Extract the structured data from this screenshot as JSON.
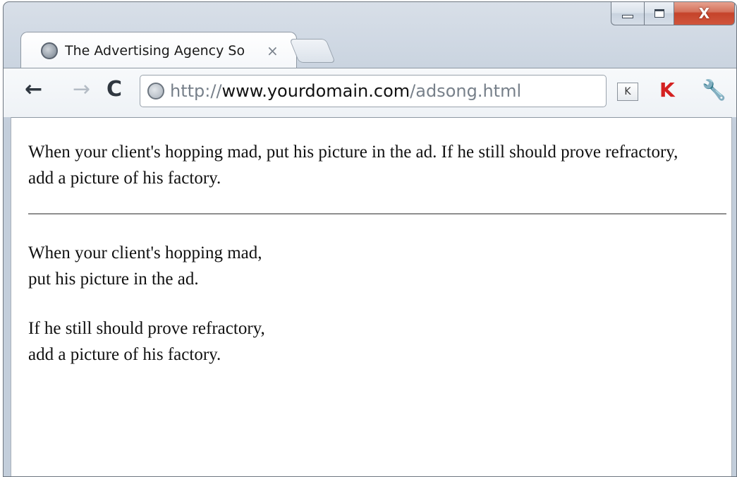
{
  "browser": {
    "tab": {
      "title": "The Advertising Agency So",
      "close_glyph": "×"
    },
    "caption_buttons": {
      "minimize": "minimize",
      "maximize": "maximize",
      "close_glyph": "X"
    },
    "toolbar": {
      "back_glyph": "←",
      "forward_glyph": "→",
      "reload_glyph": "C",
      "url": {
        "scheme": "http://",
        "host": "www.yourdomain.com",
        "path": "/adsong.html"
      },
      "extensions": [
        {
          "name": "k-extension-icon",
          "glyph": "K"
        },
        {
          "name": "kaspersky-icon",
          "glyph": "K"
        },
        {
          "name": "wrench-icon",
          "glyph": "🔧"
        }
      ]
    }
  },
  "page": {
    "paragraph": "When your client's hopping mad, put his picture in the ad. If he still should prove refractory, add a picture of his factory.",
    "stanzas": [
      {
        "lines": [
          "When your client's hopping mad,",
          "put his picture in the ad."
        ]
      },
      {
        "lines": [
          "If he still should prove refractory,",
          "add a picture of his factory."
        ]
      }
    ]
  },
  "colors": {
    "chrome_frame": "#cfd8e3",
    "close_button": "#c5432a",
    "url_host": "#111111",
    "url_muted": "#77808a",
    "rule": "#8f8f8f"
  }
}
